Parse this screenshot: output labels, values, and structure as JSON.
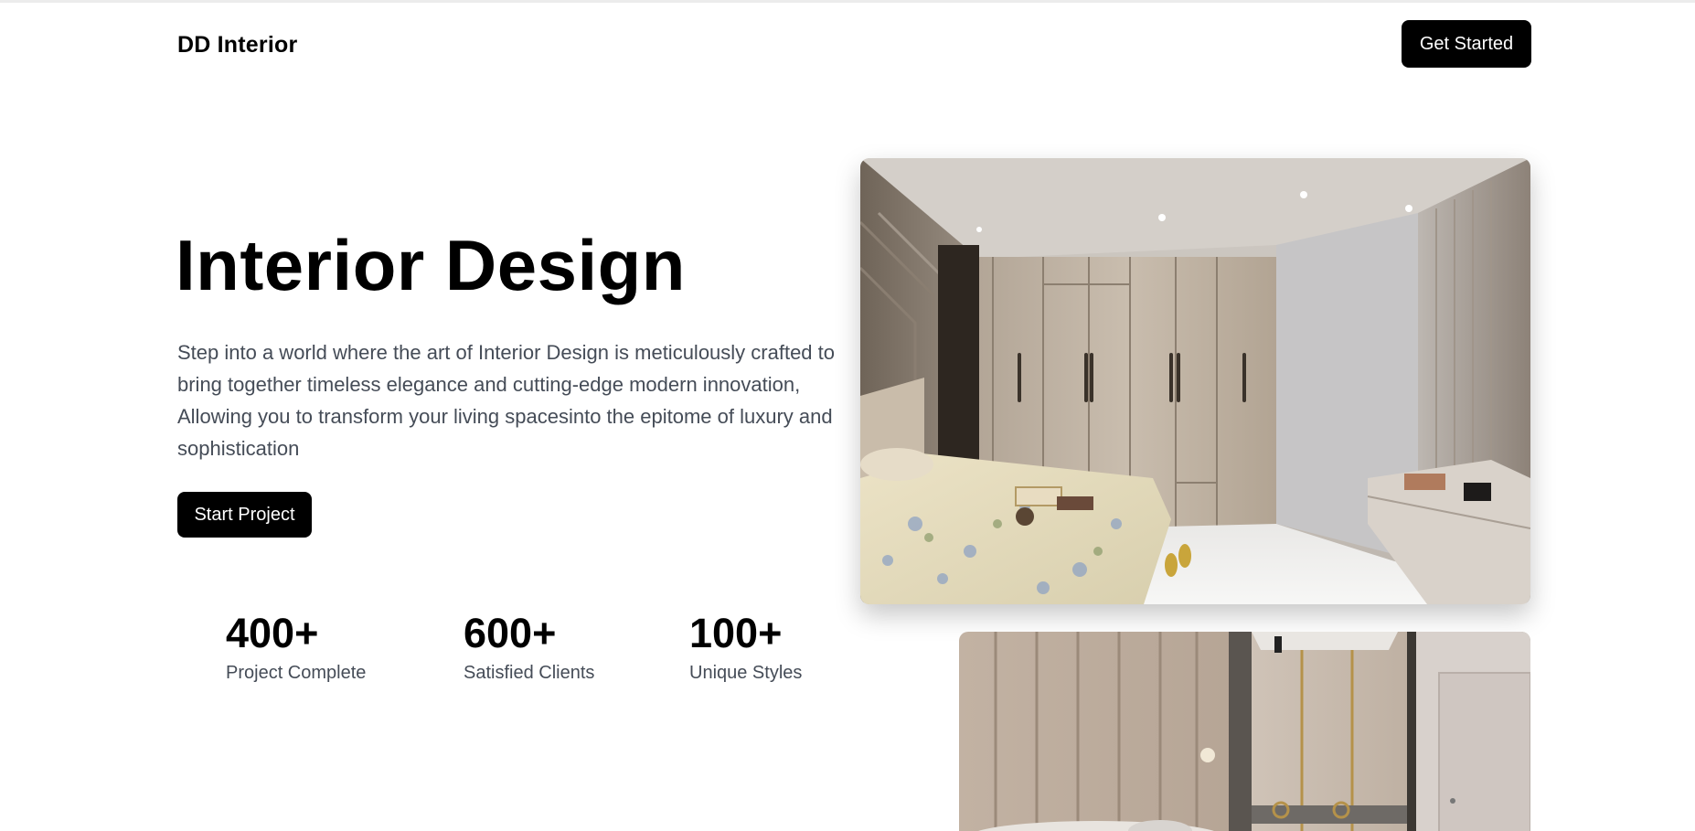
{
  "header": {
    "brand": "DD Interior",
    "cta_label": "Get Started"
  },
  "hero": {
    "title": "Interior Design",
    "description": "Step into a world where the art of Interior Design is meticulously crafted to bring together timeless elegance and cutting-edge modern innovation, Allowing you to transform your living spacesinto the epitome of luxury and sophistication",
    "cta_label": "Start Project"
  },
  "stats": [
    {
      "value": "400+",
      "label": "Project Complete"
    },
    {
      "value": "600+",
      "label": "Satisfied Clients"
    },
    {
      "value": "100+",
      "label": "Unique Styles"
    }
  ],
  "images": [
    {
      "name": "bedroom-wardrobe-photo"
    },
    {
      "name": "bedroom-headboard-photo"
    }
  ],
  "colors": {
    "primary": "#000000",
    "text_muted": "#454c57",
    "background": "#ffffff"
  }
}
